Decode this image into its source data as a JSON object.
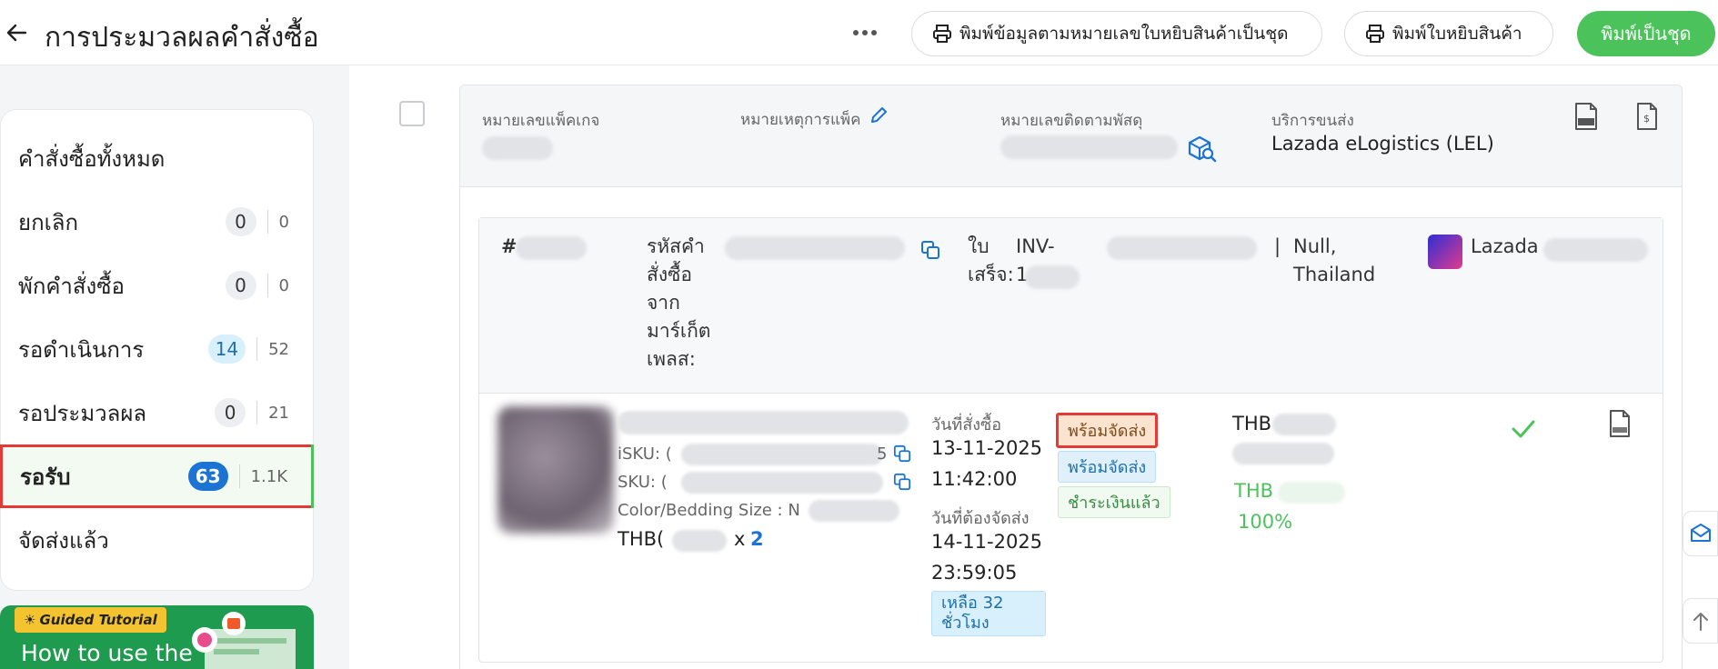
{
  "header": {
    "title": "การประมวลผลคำสั่งซื้อ",
    "print_bulk_label": "พิมพ์ข้อมูลตามหมายเลขใบหยิบสินค้าเป็นชุด",
    "print_slip_label": "พิมพ์ใบหยิบสินค้า",
    "print_batch_label": "พิมพ์เป็นชุด"
  },
  "sidebar": {
    "items": [
      {
        "label": "คำสั่งซื้อทั้งหมด"
      },
      {
        "label": "ยกเลิก",
        "count": "0",
        "total": "0"
      },
      {
        "label": "พักคำสั่งซื้อ",
        "count": "0",
        "total": "0"
      },
      {
        "label": "รอดำเนินการ",
        "count": "14",
        "total": "52"
      },
      {
        "label": "รอประมวลผล",
        "count": "0",
        "total": "21"
      },
      {
        "label": "รอรับ",
        "count": "63",
        "total": "1.1K"
      },
      {
        "label": "จัดส่งแล้ว"
      }
    ],
    "tutorial": {
      "badge": "Guided Tutorial",
      "text": "How to use the"
    }
  },
  "package": {
    "package_no_label": "หมายเลขแพ็คเกจ",
    "pack_note_label": "หมายเหตุการแพ็ค",
    "tracking_label": "หมายเลขติดตามพัสดุ",
    "shipping_label": "บริการขนส่ง",
    "shipping_value": "Lazada eLogistics (LEL)"
  },
  "order": {
    "hash": "#",
    "marketplace_id_label": "รหัสคำสั่งซื้อจากมาร์เก็ตเพลส:",
    "receipt_label": "ใบเสร็จ:",
    "invoice_prefix": "INV-",
    "invoice_suffix": "1",
    "separator": "|",
    "address": "Null, Thailand",
    "platform": "Lazada",
    "isku_label": "iSKU: (",
    "isku_tail": "5",
    "sku_label": "SKU: (",
    "variant_label": "Color/Bedding Size : N",
    "price_prefix": "THB(",
    "qty_x": "x",
    "qty": "2",
    "order_date_label": "วันที่สั่งซื้อ",
    "order_date": "13-11-2025",
    "order_time": "11:42:00",
    "ship_by_label": "วันที่ต้องจัดส่ง",
    "ship_by_date": "14-11-2025",
    "ship_by_time": "23:59:05",
    "remaining_l1": "เหลือ 32",
    "remaining_l2": "ชั่วโมง",
    "status_ready": "พร้อมจัดส่ง",
    "status_ready2": "พร้อมจัดส่ง",
    "status_paid": "ชำระเงินแล้ว",
    "amount_currency": "THB",
    "amount_currency_green": "THB",
    "percent": "100%"
  },
  "colors": {
    "accent_green": "#4cc35a",
    "accent_blue": "#1b74d4",
    "highlight_red": "#e53935"
  }
}
